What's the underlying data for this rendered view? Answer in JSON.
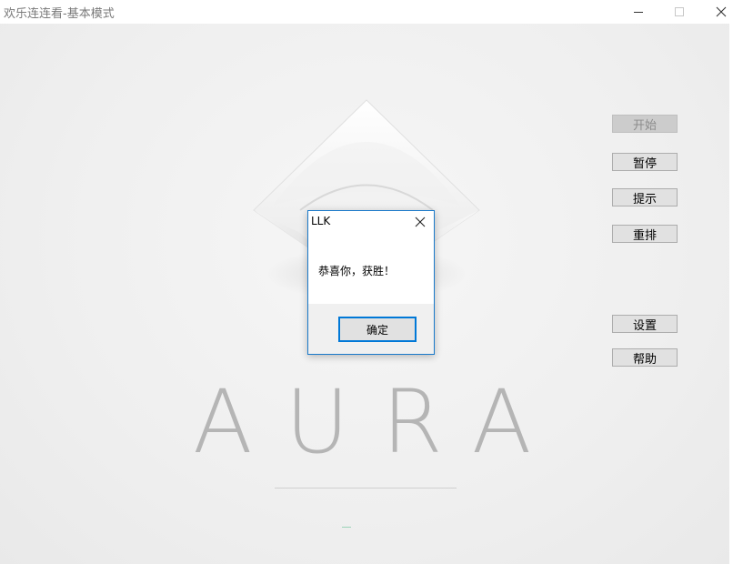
{
  "window": {
    "title": "欢乐连连看-基本模式",
    "minimize_glyph": "—",
    "maximize_glyph": "☐",
    "close_glyph": "✕"
  },
  "buttons": {
    "start": "开始",
    "pause": "暂停",
    "hint": "提示",
    "reshuffle": "重排",
    "settings": "设置",
    "help": "帮助"
  },
  "background": {
    "logo_text": "AURA",
    "logo_color": "#b5b5b5"
  },
  "dialog": {
    "title": "LLK",
    "message": "恭喜你，获胜！",
    "ok_label": "确定",
    "accent": "#0078d7"
  }
}
